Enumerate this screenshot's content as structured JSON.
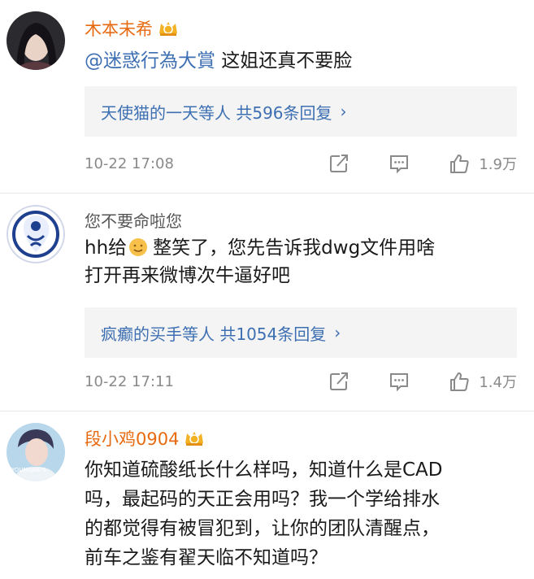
{
  "comments": [
    {
      "username": "木本未希",
      "mention": "@迷惑行為大賞",
      "text": " 这姐还真不要脸",
      "reply_summary": "天使猫的一天等人 共596条回复",
      "time": "10-22 17:08",
      "likes": "1.9万",
      "vip": true
    },
    {
      "username": "您不要命啦您",
      "text_line1": "hh给",
      "text_line1_rest": "整笑了，您先告诉我dwg文件用啥",
      "text_line2": "打开再来微博次牛逼好吧",
      "reply_summary": "疯癫的买手等人 共1054条回复",
      "time": "10-22 17:11",
      "likes": "1.4万",
      "vip": false
    },
    {
      "username": "段小鸡0904",
      "text_lines": [
        "你知道硫酸纸长什么样吗，知道什么是CAD",
        "吗，最起码的天正会用吗？我一个学给排水",
        "的都觉得有被冒犯到，让你的团队清醒点，",
        "前车之鉴有翟天临不知道吗？"
      ],
      "vip": true
    }
  ],
  "icons": {
    "reply_chevron": "chevron-right-icon",
    "share": "share-icon",
    "comment": "comment-icon",
    "like": "thumbs-up-icon",
    "vip_badge": "vip-crown-icon",
    "emoji": "smiling-face-icon"
  },
  "colors": {
    "vip_name": "#e86a10",
    "link_blue": "#3d6fb2",
    "meta_gray": "#8a8a8a",
    "reply_bg": "#f4f4f4"
  }
}
